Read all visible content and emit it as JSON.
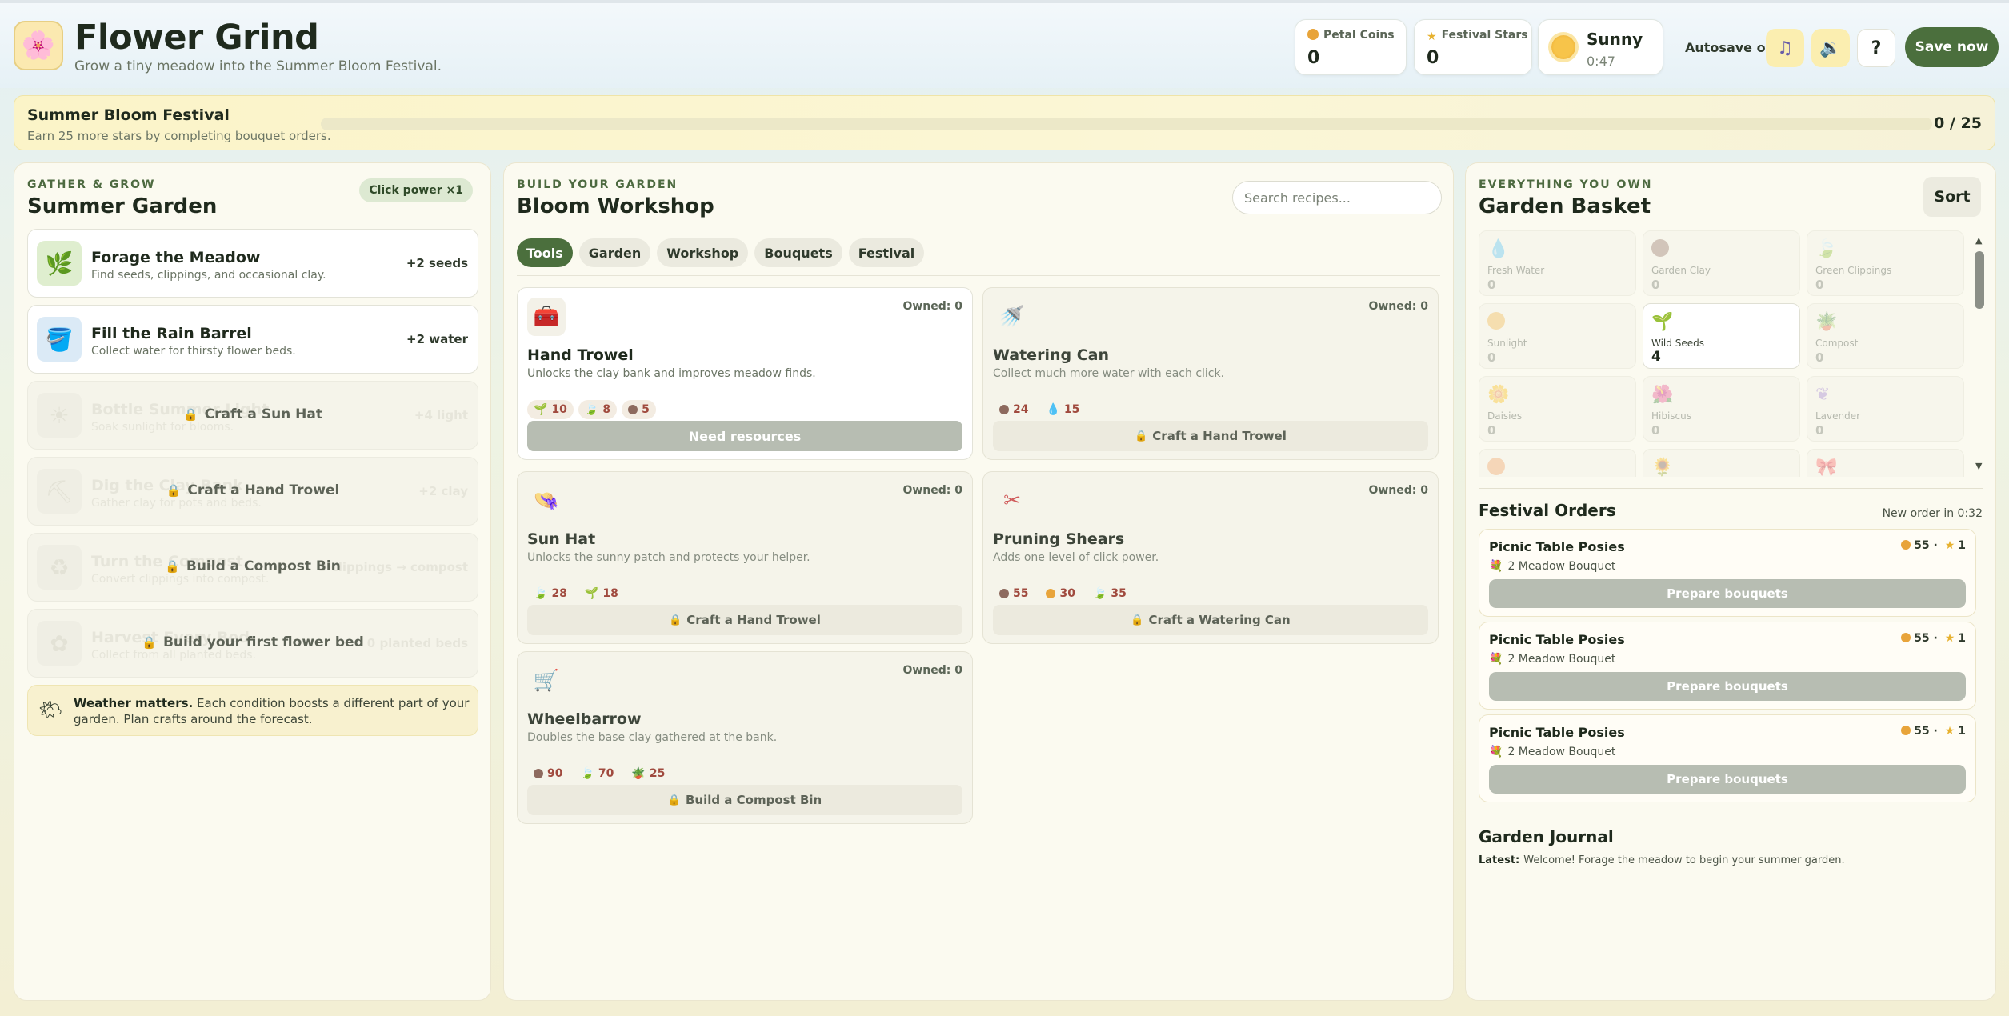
{
  "app": {
    "title": "Flower Grind",
    "subtitle": "Grow a tiny meadow into the Summer Bloom Festival.",
    "logo_icon": "flower-logo"
  },
  "stats": {
    "coins_label": "Petal Coins",
    "coins_value": "0",
    "stars_label": "Festival Stars",
    "stars_value": "0",
    "weather_name": "Sunny",
    "weather_time": "0:47"
  },
  "header_controls": {
    "autosave_label": "Autosave on",
    "music_icon": "music-note-icon",
    "sound_icon": "speaker-icon",
    "help_label": "?",
    "save_label": "Save now"
  },
  "festival": {
    "title": "Summer Bloom Festival",
    "subtitle": "Earn 25 more stars by completing bouquet orders.",
    "progress_text": "0 / 25",
    "progress_fraction": 0.0
  },
  "garden": {
    "kicker": "Gather & Grow",
    "title": "Summer Garden",
    "click_power": "Click power ×1",
    "actions": [
      {
        "name": "Forage the Meadow",
        "desc": "Find seeds, clippings, and occasional clay.",
        "gain": "+2 seeds",
        "icon": "twig-icon",
        "locked": false
      },
      {
        "name": "Fill the Rain Barrel",
        "desc": "Collect water for thirsty flower beds.",
        "gain": "+2 water",
        "icon": "bucket-icon",
        "locked": false
      },
      {
        "name": "Bottle Summer Light",
        "desc": "Soak sunlight for blooms.",
        "gain": "+4 light",
        "lock_text": "Craft a Sun Hat",
        "locked": true
      },
      {
        "name": "Dig the Clay Bank",
        "desc": "Gather clay for pots and beds.",
        "gain": "+2 clay",
        "lock_text": "Craft a Hand Trowel",
        "locked": true
      },
      {
        "name": "Turn the Compost",
        "desc": "Convert clippings into compost.",
        "gain": "3 clippings → compost",
        "lock_text": "Build a Compost Bin",
        "locked": true
      },
      {
        "name": "Harvest Every Bed",
        "desc": "Collect from all planted beds.",
        "gain": "0 planted beds",
        "lock_text": "Build your first flower bed",
        "locked": true
      }
    ],
    "tip_bold": "Weather matters.",
    "tip_text": "Each condition boosts a different part of your garden. Plan crafts around the forecast."
  },
  "workshop": {
    "kicker": "Build your garden",
    "title": "Bloom Workshop",
    "search_placeholder": "Search recipes...",
    "tabs": [
      "Tools",
      "Garden",
      "Workshop",
      "Bouquets",
      "Festival"
    ],
    "active_tab": "Tools",
    "recipes": [
      {
        "name": "Hand Trowel",
        "desc": "Unlocks the clay bank and improves meadow finds.",
        "owned": "Owned: 0",
        "icon": "toolbox-icon",
        "costs": [
          {
            "v": "10",
            "icon": "sprout-icon"
          },
          {
            "v": "8",
            "icon": "leaf-icon"
          },
          {
            "v": "5",
            "icon": "clay-icon"
          }
        ],
        "button": "Need resources",
        "available": true
      },
      {
        "name": "Watering Can",
        "desc": "Collect much more water with each click.",
        "owned": "Owned: 0",
        "icon": "watering-can-icon",
        "costs": [
          {
            "v": "24",
            "icon": "clay-icon"
          },
          {
            "v": "15",
            "icon": "water-drop-icon"
          }
        ],
        "button": "Craft a Hand Trowel",
        "available": false
      },
      {
        "name": "Sun Hat",
        "desc": "Unlocks the sunny patch and protects your helper.",
        "owned": "Owned: 0",
        "icon": "hat-icon",
        "costs": [
          {
            "v": "28",
            "icon": "leaf-icon"
          },
          {
            "v": "18",
            "icon": "sprout-icon"
          }
        ],
        "button": "Craft a Hand Trowel",
        "available": false
      },
      {
        "name": "Pruning Shears",
        "desc": "Adds one level of click power.",
        "owned": "Owned: 0",
        "icon": "scissors-icon",
        "costs": [
          {
            "v": "55",
            "icon": "clay-icon"
          },
          {
            "v": "30",
            "icon": "coin-icon"
          },
          {
            "v": "35",
            "icon": "leaf-icon"
          }
        ],
        "button": "Craft a Watering Can",
        "available": false
      },
      {
        "name": "Wheelbarrow",
        "desc": "Doubles the base clay gathered at the bank.",
        "owned": "Owned: 0",
        "icon": "cart-icon",
        "costs": [
          {
            "v": "90",
            "icon": "clay-icon"
          },
          {
            "v": "70",
            "icon": "leaf-icon"
          },
          {
            "v": "25",
            "icon": "compost-icon"
          }
        ],
        "button": "Build a Compost Bin",
        "available": false
      }
    ]
  },
  "basket": {
    "kicker": "Everything you own",
    "title": "Garden Basket",
    "sort_label": "Sort",
    "items": [
      {
        "name": "Fresh Water",
        "value": "0",
        "icon": "water-drop-icon",
        "has": false
      },
      {
        "name": "Garden Clay",
        "value": "0",
        "icon": "clay-icon",
        "has": false
      },
      {
        "name": "Green Clippings",
        "value": "0",
        "icon": "leaf-icon",
        "has": false
      },
      {
        "name": "Sunlight",
        "value": "0",
        "icon": "sun-icon",
        "has": false
      },
      {
        "name": "Wild Seeds",
        "value": "4",
        "icon": "sprout-icon",
        "has": true
      },
      {
        "name": "Compost",
        "value": "0",
        "icon": "compost-icon",
        "has": false
      },
      {
        "name": "Daisies",
        "value": "0",
        "icon": "daisy-icon",
        "has": false
      },
      {
        "name": "Hibiscus",
        "value": "0",
        "icon": "hibiscus-icon",
        "has": false
      },
      {
        "name": "Lavender",
        "value": "0",
        "icon": "lavender-icon",
        "has": false
      },
      {
        "name": "",
        "value": "",
        "icon": "marigold-icon",
        "has": false
      },
      {
        "name": "",
        "value": "",
        "icon": "sunflower-icon",
        "has": false
      },
      {
        "name": "",
        "value": "",
        "icon": "ribbon-icon",
        "has": false
      }
    ],
    "orders_title": "Festival Orders",
    "orders_timer": "New order in 0:32",
    "orders": [
      {
        "name": "Picnic Table Posies",
        "coins": "55",
        "stars": "1",
        "req": "2 Meadow Bouquet",
        "button": "Prepare bouquets"
      },
      {
        "name": "Picnic Table Posies",
        "coins": "55",
        "stars": "1",
        "req": "2 Meadow Bouquet",
        "button": "Prepare bouquets"
      },
      {
        "name": "Picnic Table Posies",
        "coins": "55",
        "stars": "1",
        "req": "2 Meadow Bouquet",
        "button": "Prepare bouquets"
      }
    ],
    "journal_title": "Garden Journal",
    "journal_latest_label": "Latest:",
    "journal_latest": "Welcome! Forage the meadow to begin your summer garden."
  },
  "colors": {
    "accent_green": "#4b6f3d",
    "coin": "#e8a43a",
    "star": "#e7b12e",
    "cost_text": "#a04a3e"
  }
}
